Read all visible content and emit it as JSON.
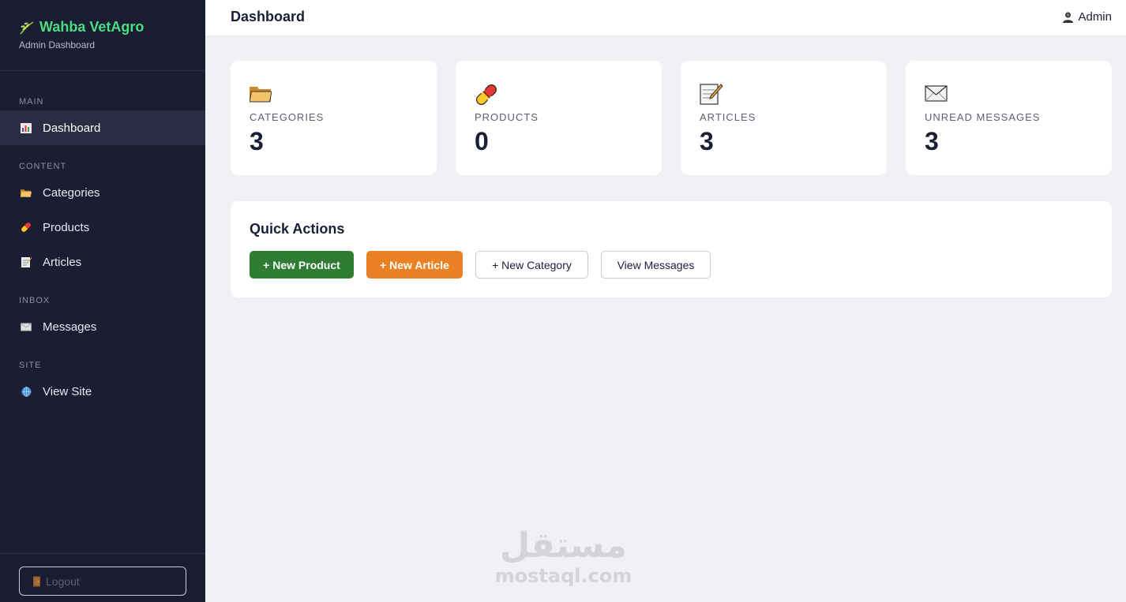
{
  "brand": {
    "title": "Wahba VetAgro",
    "subtitle": "Admin Dashboard",
    "icon": "leaf-icon",
    "color": "#4ade80"
  },
  "sidebar": {
    "sections": [
      {
        "label": "MAIN"
      },
      {
        "label": "CONTENT"
      },
      {
        "label": "INBOX"
      },
      {
        "label": "SITE"
      }
    ],
    "items": [
      {
        "label": "Dashboard",
        "icon": "bar-chart-icon",
        "active": true
      },
      {
        "label": "Categories",
        "icon": "folder-icon"
      },
      {
        "label": "Products",
        "icon": "pill-icon"
      },
      {
        "label": "Articles",
        "icon": "memo-icon"
      },
      {
        "label": "Messages",
        "icon": "envelope-icon"
      },
      {
        "label": "View Site",
        "icon": "globe-icon"
      }
    ],
    "logout": {
      "label": "Logout",
      "icon": "door-icon"
    }
  },
  "header": {
    "title": "Dashboard",
    "user": "Admin",
    "user_icon": "user-icon"
  },
  "stats": [
    {
      "label": "CATEGORIES",
      "value": "3",
      "icon": "folder-icon"
    },
    {
      "label": "PRODUCTS",
      "value": "0",
      "icon": "pill-icon"
    },
    {
      "label": "ARTICLES",
      "value": "3",
      "icon": "memo-icon"
    },
    {
      "label": "UNREAD MESSAGES",
      "value": "3",
      "icon": "envelope-icon"
    }
  ],
  "quick_actions": {
    "title": "Quick Actions",
    "buttons": [
      {
        "label": "+ New Product",
        "color": "#2e7d32"
      },
      {
        "label": "+ New Article",
        "color": "#ea8124"
      },
      {
        "label": "+ New Category"
      },
      {
        "label": "View Messages"
      }
    ]
  },
  "watermark": {
    "arabic": "مستقل",
    "text": "mostaql.com"
  }
}
